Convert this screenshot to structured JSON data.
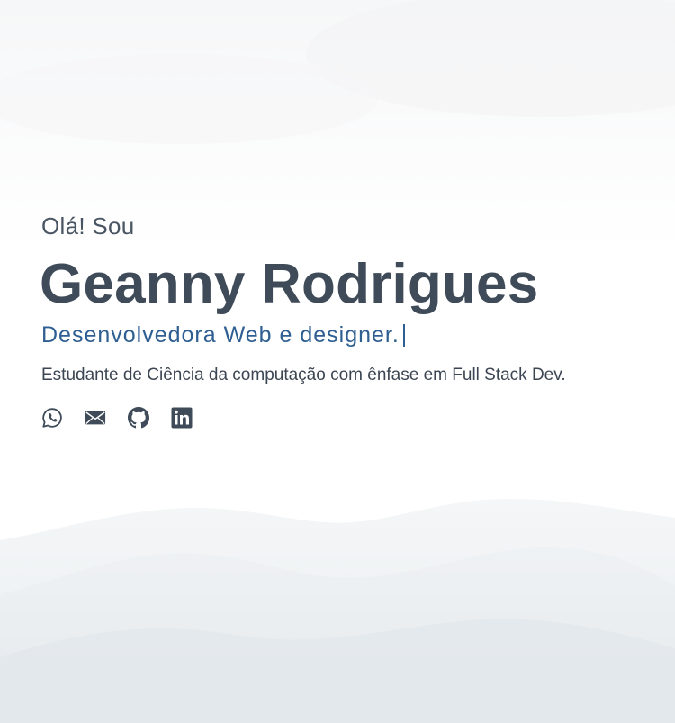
{
  "hero": {
    "greeting": "Olá! Sou",
    "name": "Geanny Rodrigues",
    "role": "Desenvolvedora Web e designer.",
    "description": "Estudante de Ciência da computação com ênfase em Full Stack Dev."
  },
  "social": {
    "icons": [
      "whatsapp-icon",
      "mail-icon",
      "github-icon",
      "linkedin-icon"
    ]
  },
  "colors": {
    "text": "#3f4b59",
    "accent": "#2f5f92",
    "background": "#ffffff"
  }
}
